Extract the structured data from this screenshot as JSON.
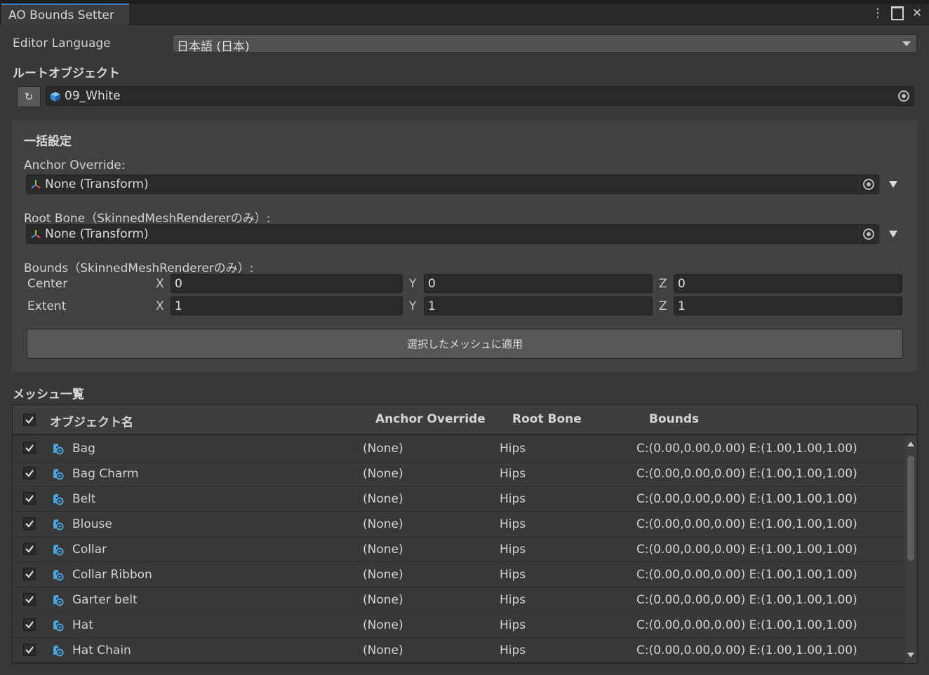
{
  "window": {
    "tab_title": "AO Bounds Setter",
    "menu_icon": "kebab-menu-icon",
    "maximize_icon": "maximize-icon",
    "close_icon": "close-icon",
    "close_glyph": "✕",
    "menu_glyph": "⋮"
  },
  "language": {
    "label": "Editor Language",
    "value": "日本語 (日本)"
  },
  "root_object": {
    "label": "ルートオブジェクト",
    "refresh_glyph": "↻",
    "value": "09_White"
  },
  "bulk": {
    "title": "一括設定",
    "anchor_label": "Anchor Override:",
    "anchor_value": "None (Transform)",
    "rootbone_label": "Root Bone（SkinnedMeshRendererのみ）:",
    "rootbone_value": "None (Transform)",
    "bounds_label": "Bounds（SkinnedMeshRendererのみ）:",
    "center_label": "Center",
    "extent_label": "Extent",
    "axis_x": "X",
    "axis_y": "Y",
    "axis_z": "Z",
    "center": {
      "x": "0",
      "y": "0",
      "z": "0"
    },
    "extent": {
      "x": "1",
      "y": "1",
      "z": "1"
    },
    "apply_label": "選択したメッシュに適用"
  },
  "mesh_list": {
    "title": "メッシュ一覧",
    "columns": {
      "name": "オブジェクト名",
      "anchor": "Anchor Override",
      "rootbone": "Root Bone",
      "bounds": "Bounds"
    },
    "header_checked": true,
    "rows": [
      {
        "checked": true,
        "name": "Bag",
        "anchor": "(None)",
        "rootbone": "Hips",
        "bounds": "C:(0.00,0.00,0.00) E:(1.00,1.00,1.00)"
      },
      {
        "checked": true,
        "name": "Bag Charm",
        "anchor": "(None)",
        "rootbone": "Hips",
        "bounds": "C:(0.00,0.00,0.00) E:(1.00,1.00,1.00)"
      },
      {
        "checked": true,
        "name": "Belt",
        "anchor": "(None)",
        "rootbone": "Hips",
        "bounds": "C:(0.00,0.00,0.00) E:(1.00,1.00,1.00)"
      },
      {
        "checked": true,
        "name": "Blouse",
        "anchor": "(None)",
        "rootbone": "Hips",
        "bounds": "C:(0.00,0.00,0.00) E:(1.00,1.00,1.00)"
      },
      {
        "checked": true,
        "name": "Collar",
        "anchor": "(None)",
        "rootbone": "Hips",
        "bounds": "C:(0.00,0.00,0.00) E:(1.00,1.00,1.00)"
      },
      {
        "checked": true,
        "name": "Collar Ribbon",
        "anchor": "(None)",
        "rootbone": "Hips",
        "bounds": "C:(0.00,0.00,0.00) E:(1.00,1.00,1.00)"
      },
      {
        "checked": true,
        "name": "Garter belt",
        "anchor": "(None)",
        "rootbone": "Hips",
        "bounds": "C:(0.00,0.00,0.00) E:(1.00,1.00,1.00)"
      },
      {
        "checked": true,
        "name": "Hat",
        "anchor": "(None)",
        "rootbone": "Hips",
        "bounds": "C:(0.00,0.00,0.00) E:(1.00,1.00,1.00)"
      },
      {
        "checked": true,
        "name": "Hat Chain",
        "anchor": "(None)",
        "rootbone": "Hips",
        "bounds": "C:(0.00,0.00,0.00) E:(1.00,1.00,1.00)"
      }
    ]
  },
  "colors": {
    "accent": "#3a79bb",
    "panel": "#383838",
    "group": "#414141",
    "field": "#2a2a2a",
    "mesh_icon": "#4aa3e0"
  }
}
